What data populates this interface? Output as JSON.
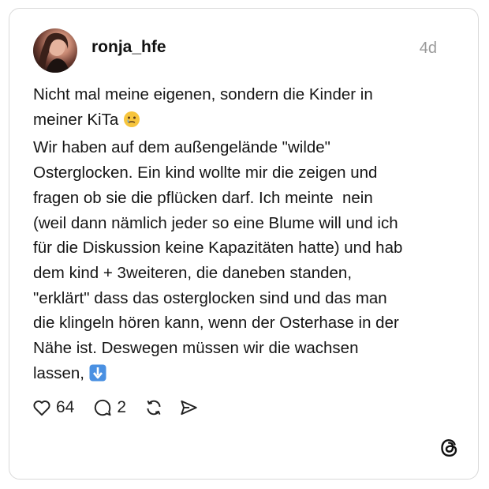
{
  "post": {
    "username": "ronja_hfe",
    "timestamp": "4d",
    "text_part1": "Nicht mal meine eigenen, sondern die Kinder in\nmeiner KiTa ",
    "text_part2": "\nWir haben auf dem außengelände \"wilde\"\nOsterglocken. Ein kind wollte mir die zeigen und\nfragen ob sie die pflücken darf. Ich meinte  nein\n(weil dann nämlich jeder so eine Blume will und ich\nfür die Diskussion keine Kapazitäten hatte) und hab\ndem kind + 3weiteren, die daneben standen,\n\"erklärt\" dass das osterglocken sind und das man\ndie klingeln hören kann, wenn der Osterhase in der\nNähe ist. Deswegen müssen wir die wachsen\nlassen, ",
    "emoji_1": "face-holding-back-tears-icon",
    "emoji_2": "down-arrow-icon"
  },
  "actions": {
    "like_count": "64",
    "reply_count": "2"
  },
  "colors": {
    "card_border": "#d9d9d9",
    "timestamp": "#9a9a9a",
    "down_arrow_bg": "#4a90e2"
  }
}
